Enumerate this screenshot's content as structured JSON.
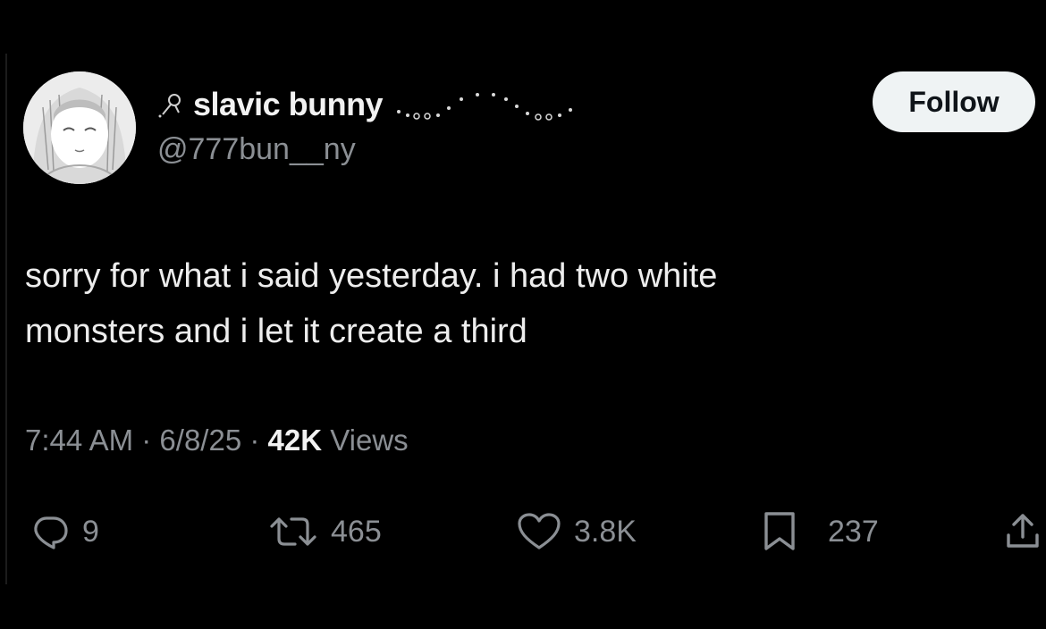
{
  "user": {
    "display_name": "slavic bunny",
    "handle": "@777bun__ny"
  },
  "follow_label": "Follow",
  "tweet": {
    "text_line_1": "sorry for what i said yesterday. i had two white",
    "text_line_2": "monsters and i let it create a third"
  },
  "meta": {
    "time": "7:44 AM",
    "separator": "·",
    "date": "6/8/25",
    "views_count": "42K",
    "views_label": "Views"
  },
  "actions": {
    "replies": "9",
    "reposts": "465",
    "likes": "3.8K",
    "bookmarks": "237"
  },
  "icons": {
    "reply": "reply-icon",
    "repost": "repost-icon",
    "like": "heart-icon",
    "bookmark": "bookmark-icon",
    "share": "share-icon"
  },
  "colors": {
    "background": "#000000",
    "primary_text": "#e7e9ea",
    "secondary_text": "#8b8f94",
    "follow_bg": "#eff3f4"
  }
}
